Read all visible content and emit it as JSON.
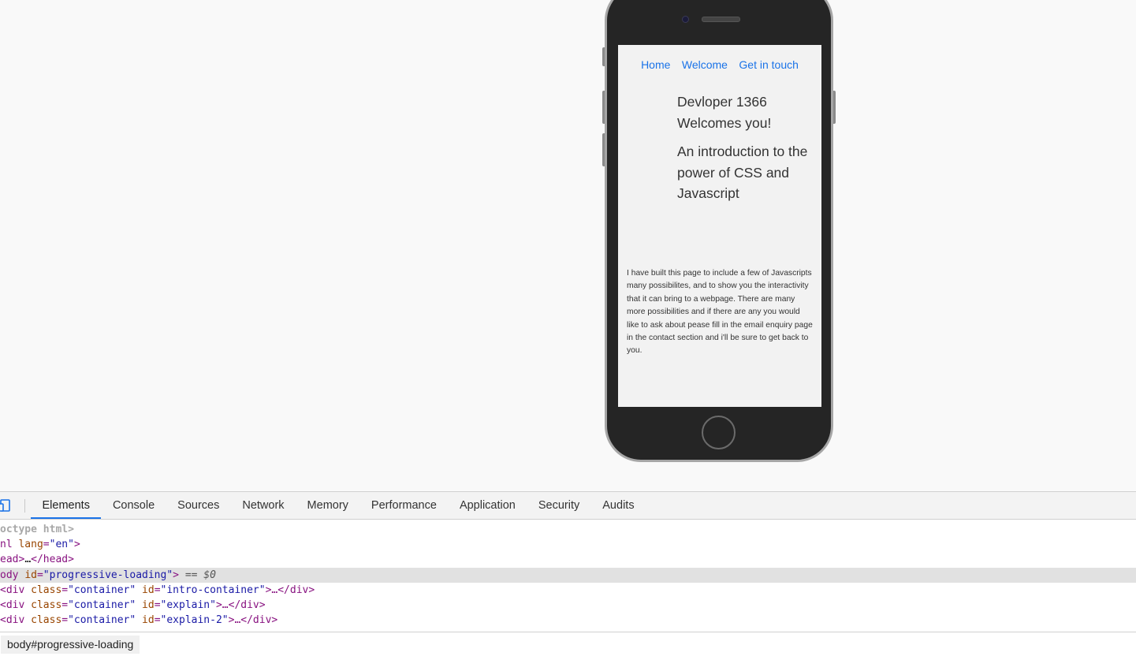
{
  "viewport": {
    "nav": [
      "Home",
      "Welcome",
      "Get in touch"
    ],
    "heading1": "Devloper 1366 Welcomes you!",
    "heading2": "An introduction to the power of CSS and Javascript",
    "intro": "I have built this page to include a few of Javascripts many possibilites, and to show you the interactivity that it can bring to a webpage. There are many more possibilities and if there are any you would like to ask about pease fill in the email enquiry page in the contact section and i'll be sure to get back to you."
  },
  "devtools": {
    "tabs": [
      "Elements",
      "Console",
      "Sources",
      "Network",
      "Memory",
      "Performance",
      "Application",
      "Security",
      "Audits"
    ],
    "active_tab": "Elements",
    "dom": {
      "doctype": "octype html>",
      "html_tag": "nl",
      "html_attr": "lang",
      "html_val": "\"en\"",
      "head_open": "ead",
      "head_ellipsis": "…",
      "head_close": "</head>",
      "body_tag": "ody",
      "body_attr": "id",
      "body_val": "\"progressive-loading\"",
      "body_eq": "== $0",
      "rows": [
        {
          "tag": "div",
          "class_attr": "class",
          "class_val": "\"container\"",
          "id_attr": "id",
          "id_val": "\"intro-container\"",
          "tail": "…</div>"
        },
        {
          "tag": "div",
          "class_attr": "class",
          "class_val": "\"container\"",
          "id_attr": "id",
          "id_val": "\"explain\"",
          "tail": "…</div>"
        },
        {
          "tag": "div",
          "class_attr": "class",
          "class_val": "\"container\"",
          "id_attr": "id",
          "id_val": "\"explain-2\"",
          "tail": "…</div>"
        }
      ]
    },
    "breadcrumb": "body#progressive-loading"
  }
}
